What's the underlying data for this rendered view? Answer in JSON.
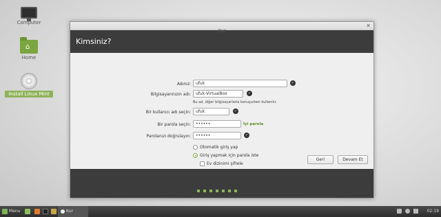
{
  "desktop": {
    "icons": [
      {
        "label": "Computer"
      },
      {
        "label": "Home"
      },
      {
        "label": "Install Linux Mint"
      }
    ]
  },
  "window": {
    "title": "Kur",
    "heading": "Kimsiniz?"
  },
  "form": {
    "name_label": "Adınız:",
    "name_value": "ufuk",
    "computer_label": "Bilgisayarınızın adı:",
    "computer_value": "ufuk-VirtualBox",
    "computer_hint": "Bu ad, diğer bilgisayarlarla konuşurken kullanılır.",
    "username_label": "Bir kullanıcı adı seçin:",
    "username_value": "ufuk",
    "password_label": "Bir parola seçin:",
    "password_value": "••••••",
    "password_strength": "İyi parola",
    "confirm_label": "Parolanızı doğrulayın:",
    "confirm_value": "••••••",
    "opt_autologin": "Otomatik giriş yap",
    "opt_require_password": "Giriş yapmak için parola iste",
    "opt_encrypt_home": "Ev dizinimi şifrele",
    "selected_option": "opt_require_password"
  },
  "buttons": {
    "back": "Geri",
    "continue": "Devam Et"
  },
  "progress": {
    "total_steps": 7,
    "accent": "#8fb35a"
  },
  "taskbar": {
    "menu_label": "Menu",
    "task_label": "Kur",
    "clock": "02:19"
  },
  "colors": {
    "accent": "#8fb35a",
    "header_bg": "#3c3c3c"
  }
}
